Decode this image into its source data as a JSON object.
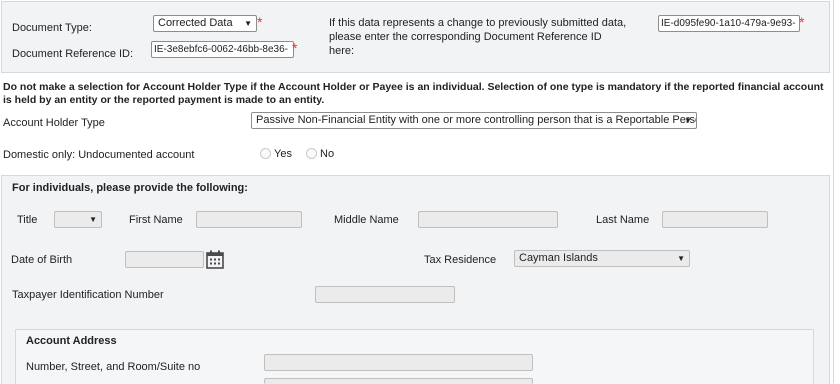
{
  "top": {
    "document_type_label": "Document Type:",
    "document_type_value": "Corrected Data",
    "doc_ref_label": "Document Reference ID:",
    "doc_ref_value": "IE-3e8ebfc6-0062-46bb-8e36-",
    "correction_note": "If this data represents a change to previously submitted data, please enter the corresponding Document Reference ID here:",
    "corresponding_ref_value": "IE-d095fe90-1a10-479a-9e93-",
    "required_mark": "*"
  },
  "notice": "Do not make a selection for Account Holder Type if the Account Holder or Payee is an individual. Selection of one type is mandatory if the reported financial account is held by an entity or the reported payment is made to an entity.",
  "account_holder": {
    "label": "Account Holder Type",
    "value": "Passive Non-Financial Entity with one or more controlling person that is a Reportable Person"
  },
  "domestic": {
    "label": "Domestic only: Undocumented account",
    "yes_label": "Yes",
    "no_label": "No"
  },
  "individuals": {
    "heading": "For individuals, please provide the following:",
    "title_label": "Title",
    "title_value": "",
    "first_name_label": "First Name",
    "middle_name_label": "Middle Name",
    "last_name_label": "Last Name",
    "dob_label": "Date of Birth",
    "tax_residence_label": "Tax Residence",
    "tax_residence_value": "Cayman Islands",
    "tin_label": "Taxpayer Identification Number"
  },
  "address": {
    "heading": "Account Address",
    "street_label": "Number, Street, and Room/Suite no"
  },
  "icons": {
    "dropdown_arrow": "▼",
    "calendar": "calendar-icon"
  }
}
